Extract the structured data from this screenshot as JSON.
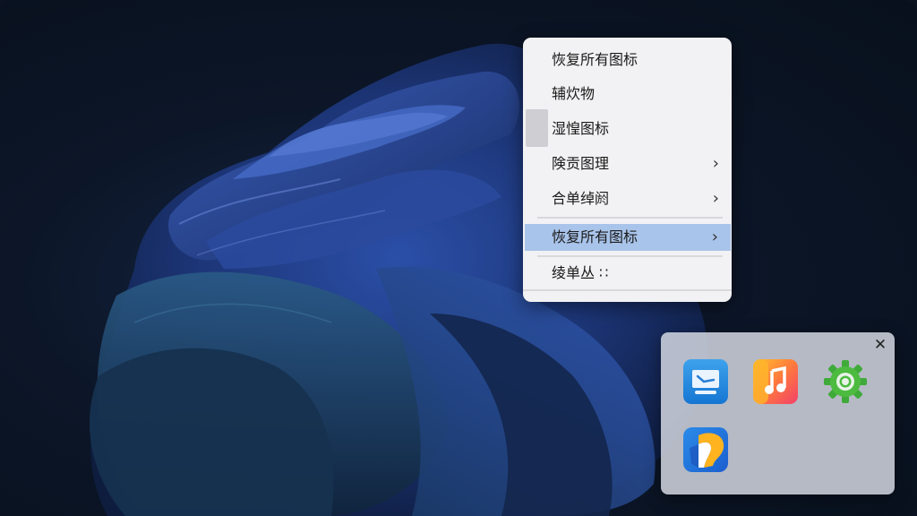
{
  "context_menu": {
    "items": [
      {
        "label": "恢复所有图标",
        "submenu": false
      },
      {
        "label": "辅炊物",
        "submenu": false
      },
      {
        "label": "湿惶图标",
        "submenu": false
      },
      {
        "label": "険贡图理",
        "submenu": true
      },
      {
        "label": "合单绰阏",
        "submenu": true
      },
      {
        "label": "恢复所有图标",
        "submenu": true,
        "highlighted": true
      },
      {
        "label": "绫单丛 ∷",
        "submenu": false
      }
    ],
    "submenu_glyph": "›",
    "highlight_color": "#a9c4ea"
  },
  "tray_popup": {
    "close_glyph": "✕",
    "icons": [
      "monitor-app-icon",
      "music-app-icon",
      "settings-gear-icon",
      "colorful-app-icon"
    ]
  }
}
